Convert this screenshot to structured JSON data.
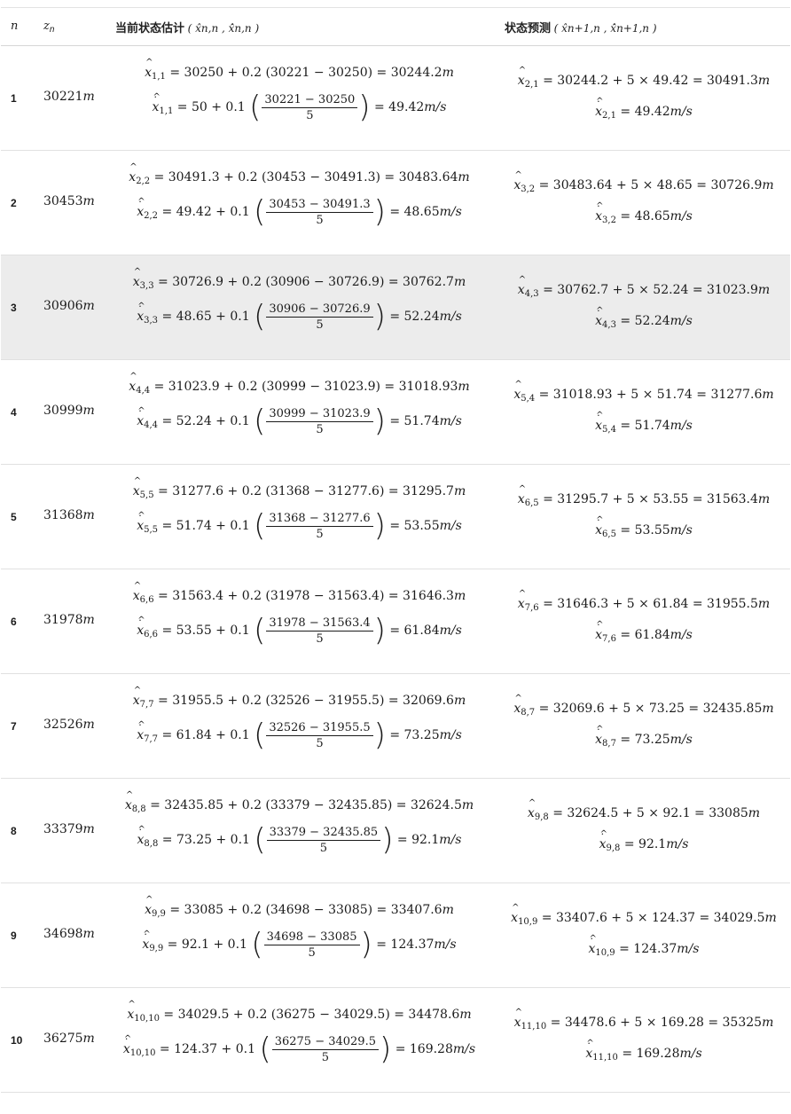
{
  "header": {
    "col_n": "n",
    "col_z": "z",
    "col_z_sub": "n",
    "col_estimate_label": "当前状态估计",
    "col_estimate_vars": "( x̂n,n , x̂̇n,n )",
    "col_predict_label": "状态预测",
    "col_predict_vars": "( x̂n+1,n , x̂̇n+1,n )"
  },
  "rows": [
    {
      "n": "1",
      "z": "30221",
      "unit_z": "m",
      "pos_sub": "1,1",
      "pos_eq": "= 30250 + 0.2 (30221 − 30250) = 30244.2",
      "pos_unit": "m",
      "vel_sub": "1,1",
      "vel_pre": "= 50 + 0.1",
      "vel_num": "30221 − 30250",
      "vel_den": "5",
      "vel_post": "= 49.42",
      "vel_unit": "m/s",
      "pred_pos_sub": "2,1",
      "pred_pos_eq": "= 30244.2 + 5 × 49.42 = 30491.3",
      "pred_pos_unit": "m",
      "pred_vel_sub": "2,1",
      "pred_vel_eq": "= 49.42",
      "pred_vel_unit": "m/s"
    },
    {
      "n": "2",
      "z": "30453",
      "unit_z": "m",
      "pos_sub": "2,2",
      "pos_eq": "= 30491.3 + 0.2 (30453 − 30491.3) = 30483.64",
      "pos_unit": "m",
      "vel_sub": "2,2",
      "vel_pre": "= 49.42 + 0.1",
      "vel_num": "30453 − 30491.3",
      "vel_den": "5",
      "vel_post": "= 48.65",
      "vel_unit": "m/s",
      "pred_pos_sub": "3,2",
      "pred_pos_eq": "= 30483.64 + 5 × 48.65 = 30726.9",
      "pred_pos_unit": "m",
      "pred_vel_sub": "3,2",
      "pred_vel_eq": "= 48.65",
      "pred_vel_unit": "m/s"
    },
    {
      "n": "3",
      "z": "30906",
      "unit_z": "m",
      "pos_sub": "3,3",
      "pos_eq": "= 30726.9 + 0.2 (30906 − 30726.9) = 30762.7",
      "pos_unit": "m",
      "vel_sub": "3,3",
      "vel_pre": "= 48.65 + 0.1",
      "vel_num": "30906 − 30726.9",
      "vel_den": "5",
      "vel_post": "= 52.24",
      "vel_unit": "m/s",
      "pred_pos_sub": "4,3",
      "pred_pos_eq": "= 30762.7 + 5 × 52.24 = 31023.9",
      "pred_pos_unit": "m",
      "pred_vel_sub": "4,3",
      "pred_vel_eq": "= 52.24",
      "pred_vel_unit": "m/s"
    },
    {
      "n": "4",
      "z": "30999",
      "unit_z": "m",
      "pos_sub": "4,4",
      "pos_eq": "= 31023.9 + 0.2 (30999 − 31023.9) = 31018.93",
      "pos_unit": "m",
      "vel_sub": "4,4",
      "vel_pre": "= 52.24 + 0.1",
      "vel_num": "30999 − 31023.9",
      "vel_den": "5",
      "vel_post": "= 51.74",
      "vel_unit": "m/s",
      "pred_pos_sub": "5,4",
      "pred_pos_eq": "= 31018.93 + 5 × 51.74 = 31277.6",
      "pred_pos_unit": "m",
      "pred_vel_sub": "5,4",
      "pred_vel_eq": "= 51.74",
      "pred_vel_unit": "m/s"
    },
    {
      "n": "5",
      "z": "31368",
      "unit_z": "m",
      "pos_sub": "5,5",
      "pos_eq": "= 31277.6 + 0.2 (31368 − 31277.6) = 31295.7",
      "pos_unit": "m",
      "vel_sub": "5,5",
      "vel_pre": "= 51.74 + 0.1",
      "vel_num": "31368 − 31277.6",
      "vel_den": "5",
      "vel_post": "= 53.55",
      "vel_unit": "m/s",
      "pred_pos_sub": "6,5",
      "pred_pos_eq": "= 31295.7 + 5 × 53.55 = 31563.4",
      "pred_pos_unit": "m",
      "pred_vel_sub": "6,5",
      "pred_vel_eq": "= 53.55",
      "pred_vel_unit": "m/s"
    },
    {
      "n": "6",
      "z": "31978",
      "unit_z": "m",
      "pos_sub": "6,6",
      "pos_eq": "= 31563.4 + 0.2 (31978 − 31563.4) = 31646.3",
      "pos_unit": "m",
      "vel_sub": "6,6",
      "vel_pre": "= 53.55 + 0.1",
      "vel_num": "31978 − 31563.4",
      "vel_den": "5",
      "vel_post": "= 61.84",
      "vel_unit": "m/s",
      "pred_pos_sub": "7,6",
      "pred_pos_eq": "= 31646.3 + 5 × 61.84 = 31955.5",
      "pred_pos_unit": "m",
      "pred_vel_sub": "7,6",
      "pred_vel_eq": "= 61.84",
      "pred_vel_unit": "m/s"
    },
    {
      "n": "7",
      "z": "32526",
      "unit_z": "m",
      "pos_sub": "7,7",
      "pos_eq": "= 31955.5 + 0.2 (32526 − 31955.5) = 32069.6",
      "pos_unit": "m",
      "vel_sub": "7,7",
      "vel_pre": "= 61.84 + 0.1",
      "vel_num": "32526 − 31955.5",
      "vel_den": "5",
      "vel_post": "= 73.25",
      "vel_unit": "m/s",
      "pred_pos_sub": "8,7",
      "pred_pos_eq": "= 32069.6 + 5 × 73.25 = 32435.85",
      "pred_pos_unit": "m",
      "pred_vel_sub": "8,7",
      "pred_vel_eq": "= 73.25",
      "pred_vel_unit": "m/s"
    },
    {
      "n": "8",
      "z": "33379",
      "unit_z": "m",
      "pos_sub": "8,8",
      "pos_eq": "= 32435.85 + 0.2 (33379 − 32435.85) = 32624.5",
      "pos_unit": "m",
      "vel_sub": "8,8",
      "vel_pre": "= 73.25 + 0.1",
      "vel_num": "33379 − 32435.85",
      "vel_den": "5",
      "vel_post": "= 92.1",
      "vel_unit": "m/s",
      "pred_pos_sub": "9,8",
      "pred_pos_eq": "= 32624.5 + 5 × 92.1 = 33085",
      "pred_pos_unit": "m",
      "pred_vel_sub": "9,8",
      "pred_vel_eq": "= 92.1",
      "pred_vel_unit": "m/s"
    },
    {
      "n": "9",
      "z": "34698",
      "unit_z": "m",
      "pos_sub": "9,9",
      "pos_eq": "= 33085 + 0.2 (34698 − 33085) = 33407.6",
      "pos_unit": "m",
      "vel_sub": "9,9",
      "vel_pre": "= 92.1 + 0.1",
      "vel_num": "34698 − 33085",
      "vel_den": "5",
      "vel_post": "= 124.37",
      "vel_unit": "m/s",
      "pred_pos_sub": "10,9",
      "pred_pos_eq": "= 33407.6 + 5 × 124.37 = 34029.5",
      "pred_pos_unit": "m",
      "pred_vel_sub": "10,9",
      "pred_vel_eq": "= 124.37",
      "pred_vel_unit": "m/s"
    },
    {
      "n": "10",
      "z": "36275",
      "unit_z": "m",
      "pos_sub": "10,10",
      "pos_eq": "= 34029.5 + 0.2 (36275 − 34029.5) = 34478.6",
      "pos_unit": "m",
      "vel_sub": "10,10",
      "vel_pre": "= 124.37 + 0.1",
      "vel_num": "36275 − 34029.5",
      "vel_den": "5",
      "vel_post": "= 169.28",
      "vel_unit": "m/s",
      "pred_pos_sub": "11,10",
      "pred_pos_eq": "= 34478.6 + 5 × 169.28 = 35325",
      "pred_pos_unit": "m",
      "pred_vel_sub": "11,10",
      "pred_vel_eq": "= 169.28",
      "pred_vel_unit": "m/s"
    }
  ]
}
